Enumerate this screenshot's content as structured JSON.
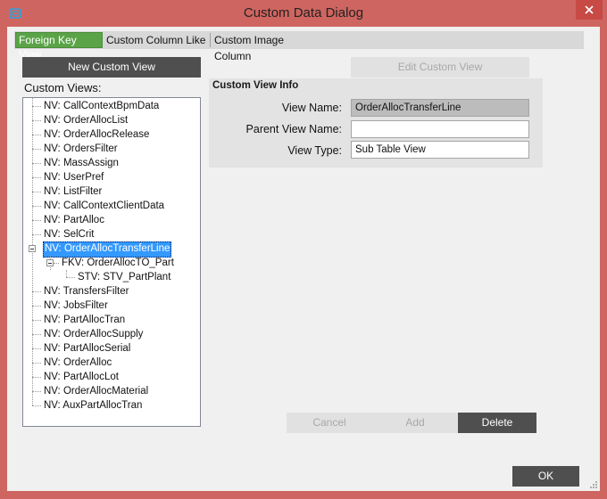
{
  "window": {
    "title": "Custom Data Dialog"
  },
  "tabs": [
    {
      "label": "Foreign Key View"
    },
    {
      "label": "Custom Column Like"
    },
    {
      "label": "Custom Image Column"
    }
  ],
  "left": {
    "new_button": "New Custom View",
    "custom_views_label": "Custom Views:",
    "tree": [
      {
        "label": "NV: CallContextBpmData"
      },
      {
        "label": "NV: OrderAllocList"
      },
      {
        "label": "NV: OrderAllocRelease"
      },
      {
        "label": "NV: OrdersFilter"
      },
      {
        "label": "NV: MassAssign"
      },
      {
        "label": "NV: UserPref"
      },
      {
        "label": "NV: ListFilter"
      },
      {
        "label": "NV: CallContextClientData"
      },
      {
        "label": "NV: PartAlloc"
      },
      {
        "label": "NV: SelCrit"
      },
      {
        "label": "NV: OrderAllocTransferLine",
        "selected": true
      },
      {
        "label": "FKV: OrderAllocTO_Part"
      },
      {
        "label": "STV: STV_PartPlant"
      },
      {
        "label": "NV: TransfersFilter"
      },
      {
        "label": "NV: JobsFilter"
      },
      {
        "label": "NV: PartAllocTran"
      },
      {
        "label": "NV: OrderAllocSupply"
      },
      {
        "label": "NV: PartAllocSerial"
      },
      {
        "label": "NV: OrderAlloc"
      },
      {
        "label": "NV: PartAllocLot"
      },
      {
        "label": "NV: OrderAllocMaterial"
      },
      {
        "label": "NV: AuxPartAllocTran"
      }
    ]
  },
  "right": {
    "edit_button": "Edit Custom View",
    "group_title": "Custom View Info",
    "view_name_label": "View Name:",
    "view_name_value": "OrderAllocTransferLine",
    "parent_view_label": "Parent View Name:",
    "parent_view_value": "",
    "view_type_label": "View Type:",
    "view_type_value": "Sub Table View"
  },
  "actions": {
    "cancel": "Cancel",
    "add": "Add",
    "delete": "Delete",
    "ok": "OK"
  },
  "colors": {
    "title_bar": "#cf6560",
    "active_tab": "#5aa447",
    "selection": "#3399ff",
    "dark_button": "#4f4f4f"
  }
}
